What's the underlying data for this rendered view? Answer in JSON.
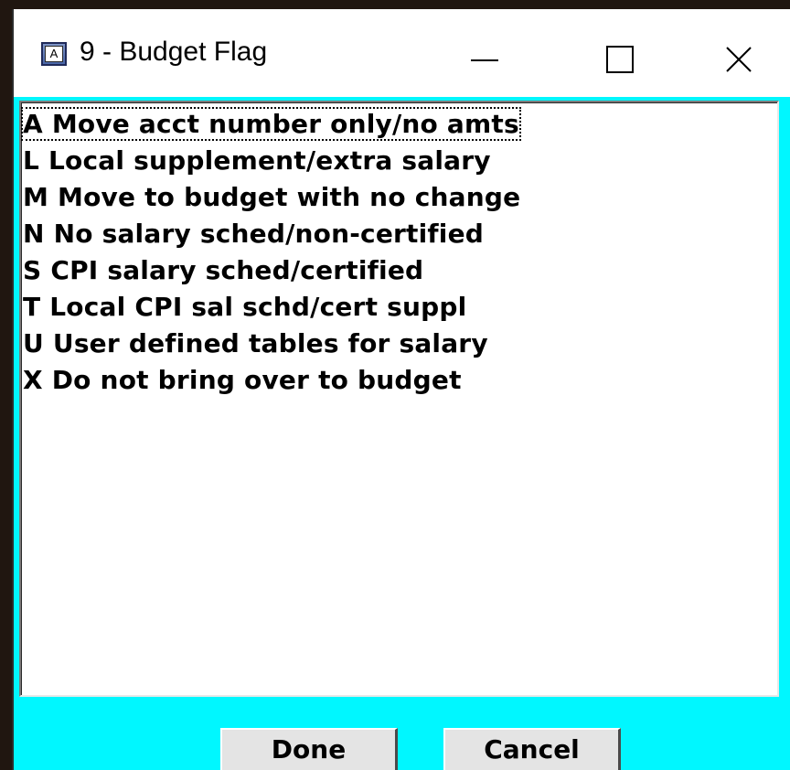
{
  "window": {
    "title": "9 - Budget Flag",
    "icon": "app-window-icon",
    "icon_letter": "A",
    "controls": {
      "minimize": "minimize-icon",
      "maximize": "maximize-icon",
      "close": "close-icon",
      "close_glyph": "✕"
    }
  },
  "list": {
    "selected_index": 0,
    "items": [
      {
        "label": "A Move acct number only/no amts"
      },
      {
        "label": "L Local supplement/extra salary"
      },
      {
        "label": "M Move to budget with no change"
      },
      {
        "label": "N No salary sched/non-certified"
      },
      {
        "label": "S CPI salary sched/certified"
      },
      {
        "label": "T Local CPI sal schd/cert suppl"
      },
      {
        "label": "U User defined tables for salary"
      },
      {
        "label": "X Do not bring over to budget"
      }
    ]
  },
  "buttons": {
    "done_label": "Done",
    "cancel_label": "Cancel"
  },
  "colors": {
    "window_background": "#00f7ff",
    "titlebar_background": "#ffffff",
    "list_background": "#ffffff"
  }
}
